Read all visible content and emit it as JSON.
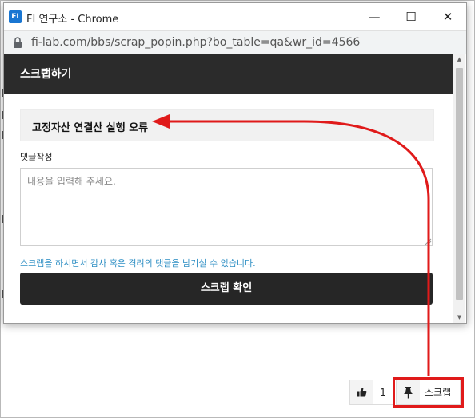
{
  "window": {
    "app_badge": "FI",
    "title": "FI 연구소 - Chrome",
    "url": "fi-lab.com/bbs/scrap_popin.php?bo_table=qa&wr_id=4566",
    "minimize_glyph": "—",
    "maximize_glyph": "☐",
    "close_glyph": "✕"
  },
  "popup": {
    "header_title": "스크랩하기",
    "subject": "고정자산 연결산 실행 오류",
    "comment_label": "댓글작성",
    "comment_placeholder": "내용을 입력해 주세요.",
    "help_text": "스크랩을 하시면서 감사 혹은 격려의 댓글을 남기실 수 있습니다.",
    "confirm_label": "스크랩 확인"
  },
  "actions": {
    "like_count": "1",
    "scrap_label": "스크랩"
  },
  "colors": {
    "header_bg": "#2b2b2b",
    "help_text": "#2f8fc4",
    "annotation_red": "#e01a1a",
    "app_badge": "#1976d2"
  },
  "icons": {
    "lock": "lock-icon",
    "thumbs_up": "thumbs-up-icon",
    "pin": "pin-icon",
    "resize": "resize-grip-icon"
  }
}
